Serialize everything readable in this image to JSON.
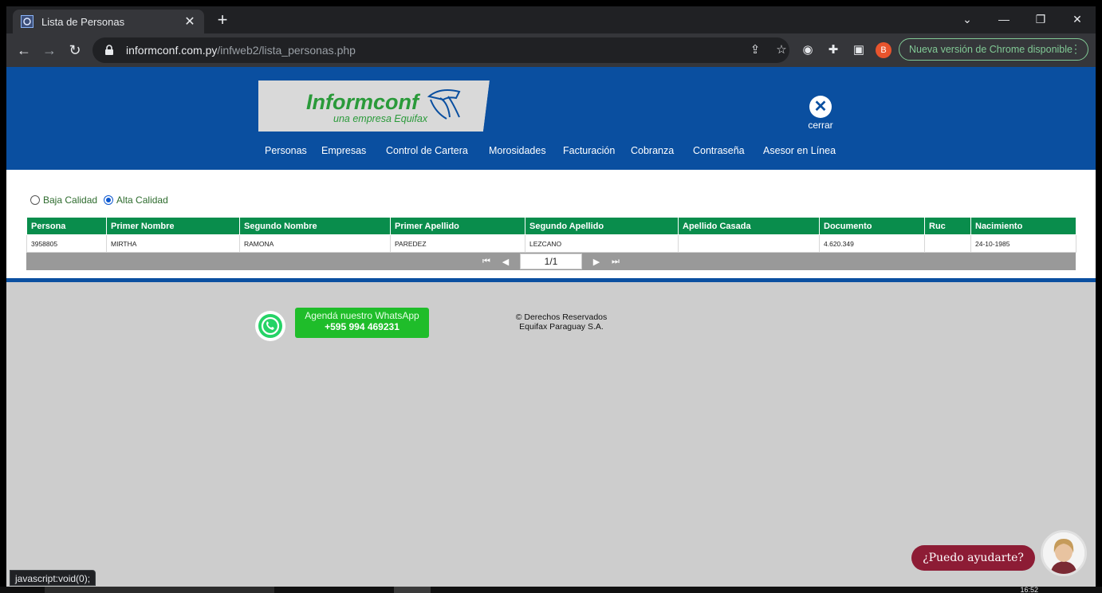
{
  "browser": {
    "tab_title": "Lista de Personas",
    "url_host": "informconf.com.py",
    "url_path": "/infweb2/lista_personas.php",
    "profile_initial": "B",
    "update_label": "Nueva versión de Chrome disponible",
    "status_text": "javascript:void(0);"
  },
  "header": {
    "logo_name": "Informconf",
    "logo_tagline": "una empresa Equifax",
    "close_label": "cerrar",
    "nav": [
      "Personas",
      "Empresas",
      "Control de Cartera",
      "Morosidades",
      "Facturación",
      "Cobranza",
      "Contraseña",
      "Asesor en Línea"
    ]
  },
  "filters": {
    "low_label": "Baja Calidad",
    "high_label": "Alta Calidad",
    "selected": "Alta Calidad"
  },
  "table": {
    "columns": [
      "Persona",
      "Primer Nombre",
      "Segundo Nombre",
      "Primer Apellido",
      "Segundo Apellido",
      "Apellido Casada",
      "Documento",
      "Ruc",
      "Nacimiento"
    ],
    "rows": [
      [
        "3958805",
        "MIRTHA",
        "RAMONA",
        "PAREDEZ",
        "LEZCANO",
        "",
        "4.620.349",
        "",
        "24-10-1985"
      ]
    ]
  },
  "pager": {
    "page": "1/1"
  },
  "footer": {
    "whatsapp_line1": "Agendá nuestro WhatsApp",
    "whatsapp_line2": "+595 994 469231",
    "copyright_line1": "© Derechos Reservados",
    "copyright_line2": "Equifax Paraguay S.A.",
    "help_label": "¿Puedo ayudarte?"
  },
  "taskbar": {
    "clock": "16:52"
  },
  "colors": {
    "header_blue": "#0a4fa0",
    "table_header_green": "#098d4c",
    "whatsapp_green": "#1fbd2a",
    "help_red": "#8d1c35",
    "footer_gray": "#cdcdcd"
  }
}
